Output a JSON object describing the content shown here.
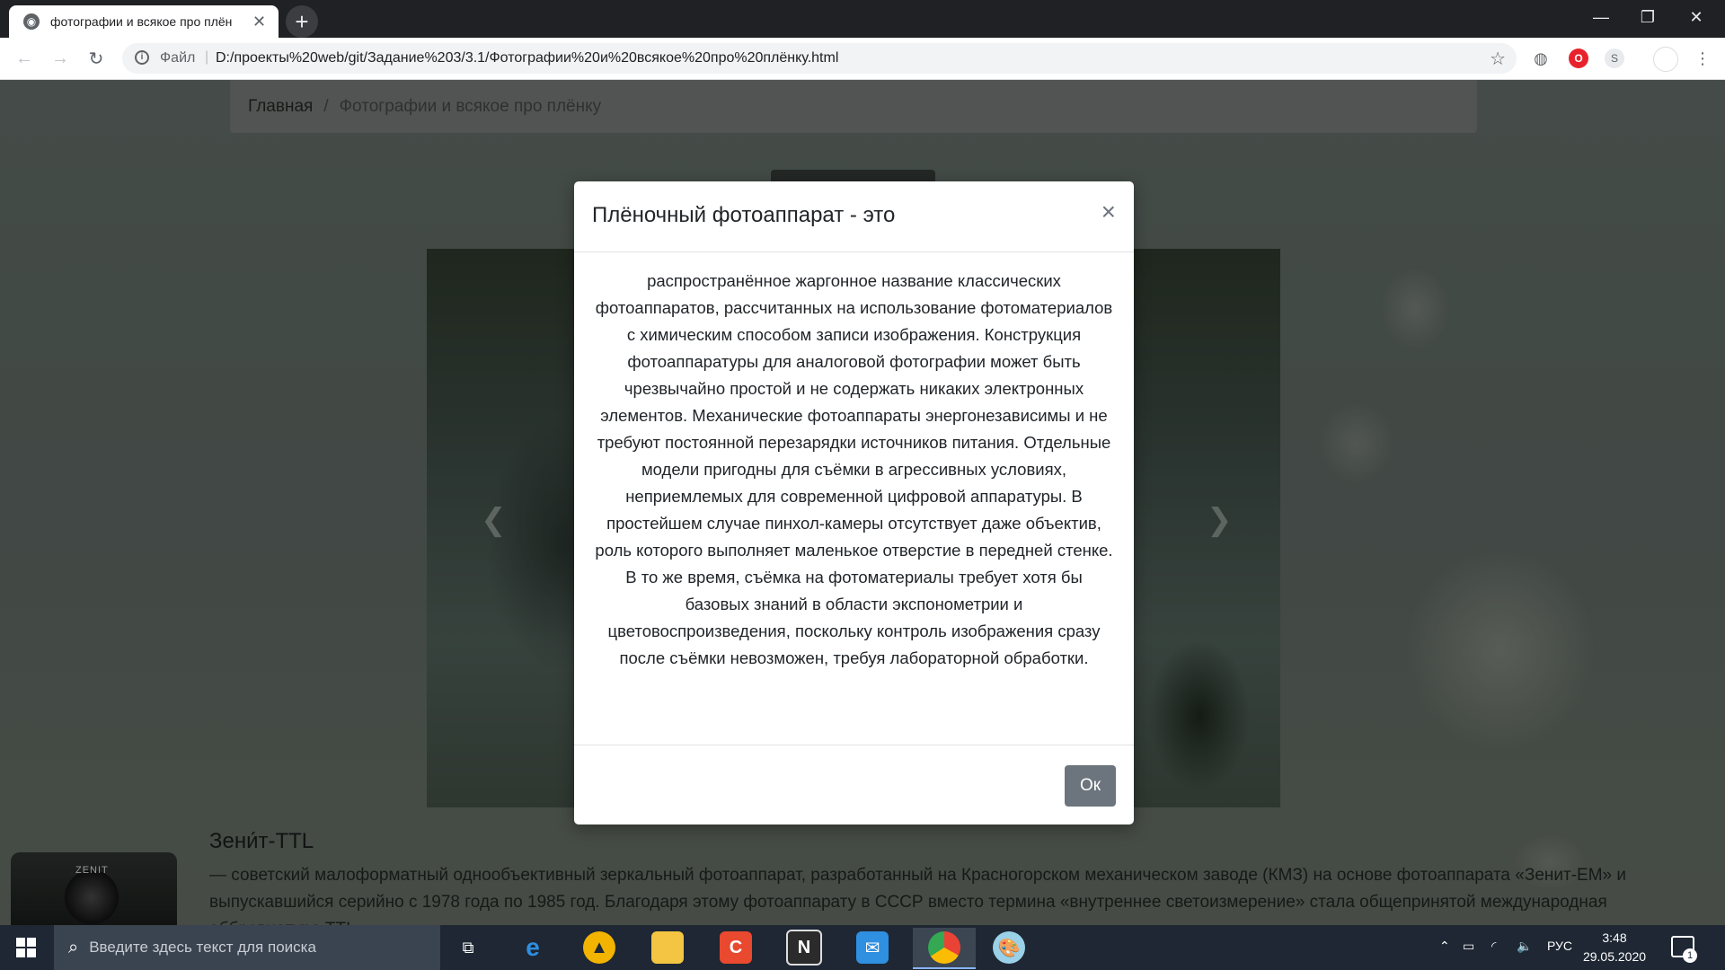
{
  "browser": {
    "tab_title": "фотографии и всякое про плён",
    "url_scheme": "Файл",
    "url": "D:/проекты%20web/git/Задание%203/3.1/Фотографии%20и%20всякое%20про%20плёнку.html",
    "ext_s_label": "S"
  },
  "page": {
    "breadcrumb": {
      "home": "Главная",
      "separator": "/",
      "current": "Фотографии и всякое про плёнку"
    },
    "section_title": "Зени́т-TTL",
    "section_text": "— советский малоформатный однообъективный зеркальный фотоаппарат, разработанный на Красногорском механическом заводе (КМЗ) на основе фотоаппарата «Зенит-ЕМ» и выпускавшийся серийно с 1978 года по 1985 год. Благодаря этому фотоаппарату в СССР вместо термина «внутреннее светоизмерение» стала общепринятой международная аббревиатура TTL",
    "camera_label": "ZENIT"
  },
  "modal": {
    "title": "Плёночный фотоаппарат - это",
    "close_label": "×",
    "body": "распространённое жаргонное название классических фотоаппаратов, рассчитанных на использование фотоматериалов с химическим способом записи изображения. Конструкция фотоаппаратуры для аналоговой фотографии может быть чрезвычайно простой и не содержать никаких электронных элементов. Механические фотоаппараты энергонезависимы и не требуют постоянной перезарядки источников питания. Отдельные модели пригодны для съёмки в агрессивных условиях, неприемлемых для современной цифровой аппаратуры. В простейшем случае пинхол-камеры отсутствует даже объектив, роль которого выполняет маленькое отверстие в передней стенке. В то же время, съёмка на фотоматериалы требует хотя бы базовых знаний в области экспонометрии и цветовоспроизведения, поскольку контроль изображения сразу после съёмки невозможен, требуя лабораторной обработки.",
    "ok_label": "Ок"
  },
  "taskbar": {
    "search_placeholder": "Введите здесь текст для поиска",
    "apps": [
      "task-view",
      "edge",
      "aimp",
      "file-explorer",
      "ccleaner",
      "notion",
      "mail",
      "chrome",
      "paint"
    ],
    "lang": "РУС",
    "time": "3:48",
    "date": "29.05.2020",
    "notification_count": "1"
  },
  "colors": {
    "modal_button": "#6c757d",
    "taskbar": "#1e2733",
    "tabbar": "#202124"
  }
}
